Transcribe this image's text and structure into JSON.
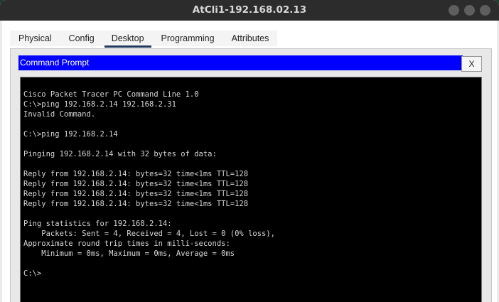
{
  "window": {
    "title": "AtCli1-192.168.02.13"
  },
  "tabs": [
    {
      "label": "Physical",
      "active": false
    },
    {
      "label": "Config",
      "active": false
    },
    {
      "label": "Desktop",
      "active": true
    },
    {
      "label": "Programming",
      "active": false
    },
    {
      "label": "Attributes",
      "active": false
    }
  ],
  "command_prompt": {
    "title": "Command Prompt",
    "close_label": "X",
    "lines": [
      "Cisco Packet Tracer PC Command Line 1.0",
      "C:\\>ping 192.168.2.14 192.168.2.31",
      "Invalid Command.",
      "",
      "C:\\>ping 192.168.2.14",
      "",
      "Pinging 192.168.2.14 with 32 bytes of data:",
      "",
      "Reply from 192.168.2.14: bytes=32 time<1ms TTL=128",
      "Reply from 192.168.2.14: bytes=32 time<1ms TTL=128",
      "Reply from 192.168.2.14: bytes=32 time<1ms TTL=128",
      "Reply from 192.168.2.14: bytes=32 time<1ms TTL=128",
      "",
      "Ping statistics for 192.168.2.14:",
      "    Packets: Sent = 4, Received = 4, Lost = 0 (0% loss),",
      "Approximate round trip times in milli-seconds:",
      "    Minimum = 0ms, Maximum = 0ms, Average = 0ms",
      "",
      "C:\\>"
    ]
  },
  "colors": {
    "header_bar": "#0000ff",
    "terminal_bg": "#000000",
    "terminal_fg": "#d8d8d8",
    "titlebar": "#2c2c2c"
  }
}
